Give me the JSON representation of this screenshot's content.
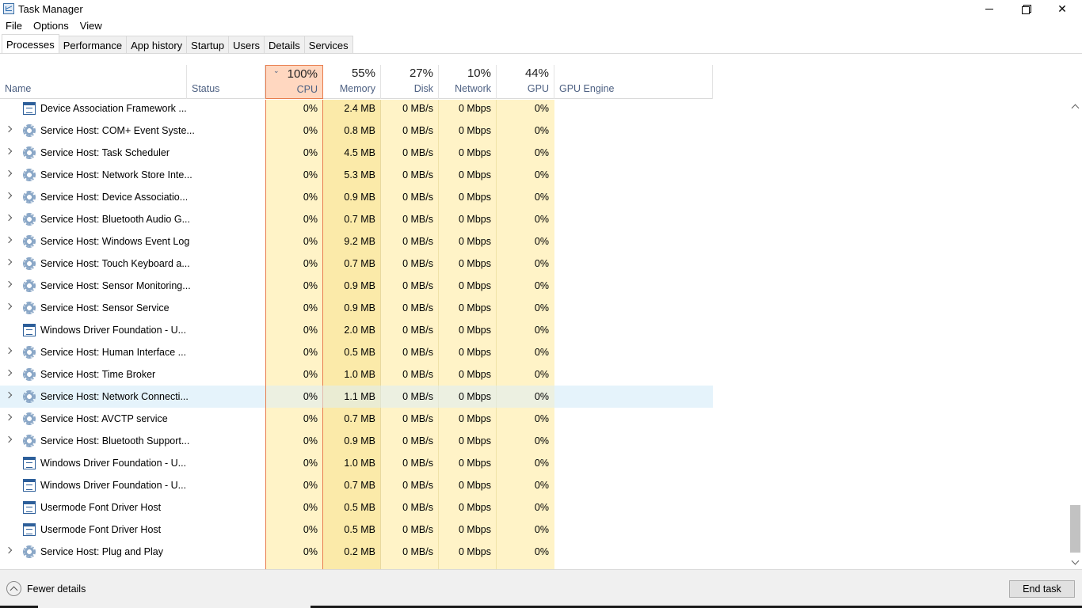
{
  "window": {
    "title": "Task Manager"
  },
  "menu": [
    "File",
    "Options",
    "View"
  ],
  "tabs": [
    {
      "label": "Processes",
      "active": true
    },
    {
      "label": "Performance",
      "active": false
    },
    {
      "label": "App history",
      "active": false
    },
    {
      "label": "Startup",
      "active": false
    },
    {
      "label": "Users",
      "active": false
    },
    {
      "label": "Details",
      "active": false
    },
    {
      "label": "Services",
      "active": false
    }
  ],
  "columns": {
    "name": {
      "label": "Name"
    },
    "status": {
      "label": "Status"
    },
    "cpu": {
      "label": "CPU",
      "percent": "100%"
    },
    "memory": {
      "label": "Memory",
      "percent": "55%"
    },
    "disk": {
      "label": "Disk",
      "percent": "27%"
    },
    "network": {
      "label": "Network",
      "percent": "10%"
    },
    "gpu": {
      "label": "GPU",
      "percent": "44%"
    },
    "gpu_engine": {
      "label": "GPU Engine"
    }
  },
  "rows": [
    {
      "name": "Device Association Framework ...",
      "icon": "app-window-icon",
      "expandable": false,
      "cpu": "0%",
      "memory": "2.4 MB",
      "disk": "0 MB/s",
      "network": "0 Mbps",
      "gpu": "0%"
    },
    {
      "name": "Service Host: COM+ Event Syste...",
      "icon": "service-gear-icon",
      "expandable": true,
      "cpu": "0%",
      "memory": "0.8 MB",
      "disk": "0 MB/s",
      "network": "0 Mbps",
      "gpu": "0%"
    },
    {
      "name": "Service Host: Task Scheduler",
      "icon": "service-gear-icon",
      "expandable": true,
      "cpu": "0%",
      "memory": "4.5 MB",
      "disk": "0 MB/s",
      "network": "0 Mbps",
      "gpu": "0%"
    },
    {
      "name": "Service Host: Network Store Inte...",
      "icon": "service-gear-icon",
      "expandable": true,
      "cpu": "0%",
      "memory": "5.3 MB",
      "disk": "0 MB/s",
      "network": "0 Mbps",
      "gpu": "0%"
    },
    {
      "name": "Service Host: Device Associatio...",
      "icon": "service-gear-icon",
      "expandable": true,
      "cpu": "0%",
      "memory": "0.9 MB",
      "disk": "0 MB/s",
      "network": "0 Mbps",
      "gpu": "0%"
    },
    {
      "name": "Service Host: Bluetooth Audio G...",
      "icon": "service-gear-icon",
      "expandable": true,
      "cpu": "0%",
      "memory": "0.7 MB",
      "disk": "0 MB/s",
      "network": "0 Mbps",
      "gpu": "0%"
    },
    {
      "name": "Service Host: Windows Event Log",
      "icon": "service-gear-icon",
      "expandable": true,
      "cpu": "0%",
      "memory": "9.2 MB",
      "disk": "0 MB/s",
      "network": "0 Mbps",
      "gpu": "0%"
    },
    {
      "name": "Service Host: Touch Keyboard a...",
      "icon": "service-gear-icon",
      "expandable": true,
      "cpu": "0%",
      "memory": "0.7 MB",
      "disk": "0 MB/s",
      "network": "0 Mbps",
      "gpu": "0%"
    },
    {
      "name": "Service Host: Sensor Monitoring...",
      "icon": "service-gear-icon",
      "expandable": true,
      "cpu": "0%",
      "memory": "0.9 MB",
      "disk": "0 MB/s",
      "network": "0 Mbps",
      "gpu": "0%"
    },
    {
      "name": "Service Host: Sensor Service",
      "icon": "service-gear-icon",
      "expandable": true,
      "cpu": "0%",
      "memory": "0.9 MB",
      "disk": "0 MB/s",
      "network": "0 Mbps",
      "gpu": "0%"
    },
    {
      "name": "Windows Driver Foundation - U...",
      "icon": "app-window-icon",
      "expandable": false,
      "cpu": "0%",
      "memory": "2.0 MB",
      "disk": "0 MB/s",
      "network": "0 Mbps",
      "gpu": "0%"
    },
    {
      "name": "Service Host: Human Interface ...",
      "icon": "service-gear-icon",
      "expandable": true,
      "cpu": "0%",
      "memory": "0.5 MB",
      "disk": "0 MB/s",
      "network": "0 Mbps",
      "gpu": "0%"
    },
    {
      "name": "Service Host: Time Broker",
      "icon": "service-gear-icon",
      "expandable": true,
      "cpu": "0%",
      "memory": "1.0 MB",
      "disk": "0 MB/s",
      "network": "0 Mbps",
      "gpu": "0%"
    },
    {
      "name": "Service Host: Network Connecti...",
      "icon": "service-gear-icon",
      "expandable": true,
      "selected": true,
      "cpu": "0%",
      "memory": "1.1 MB",
      "disk": "0 MB/s",
      "network": "0 Mbps",
      "gpu": "0%"
    },
    {
      "name": "Service Host: AVCTP service",
      "icon": "service-gear-icon",
      "expandable": true,
      "cpu": "0%",
      "memory": "0.7 MB",
      "disk": "0 MB/s",
      "network": "0 Mbps",
      "gpu": "0%"
    },
    {
      "name": "Service Host: Bluetooth Support...",
      "icon": "service-gear-icon",
      "expandable": true,
      "cpu": "0%",
      "memory": "0.9 MB",
      "disk": "0 MB/s",
      "network": "0 Mbps",
      "gpu": "0%"
    },
    {
      "name": "Windows Driver Foundation - U...",
      "icon": "app-window-icon",
      "expandable": false,
      "cpu": "0%",
      "memory": "1.0 MB",
      "disk": "0 MB/s",
      "network": "0 Mbps",
      "gpu": "0%"
    },
    {
      "name": "Windows Driver Foundation - U...",
      "icon": "app-window-icon",
      "expandable": false,
      "cpu": "0%",
      "memory": "0.7 MB",
      "disk": "0 MB/s",
      "network": "0 Mbps",
      "gpu": "0%"
    },
    {
      "name": "Usermode Font Driver Host",
      "icon": "app-window-icon",
      "expandable": false,
      "cpu": "0%",
      "memory": "0.5 MB",
      "disk": "0 MB/s",
      "network": "0 Mbps",
      "gpu": "0%"
    },
    {
      "name": "Usermode Font Driver Host",
      "icon": "app-window-icon",
      "expandable": false,
      "cpu": "0%",
      "memory": "0.5 MB",
      "disk": "0 MB/s",
      "network": "0 Mbps",
      "gpu": "0%"
    },
    {
      "name": "Service Host: Plug and Play",
      "icon": "service-gear-icon",
      "expandable": true,
      "cpu": "0%",
      "memory": "0.2 MB",
      "disk": "0 MB/s",
      "network": "0 Mbps",
      "gpu": "0%"
    }
  ],
  "footer": {
    "fewer_details": "Fewer details",
    "end_task": "End task"
  }
}
